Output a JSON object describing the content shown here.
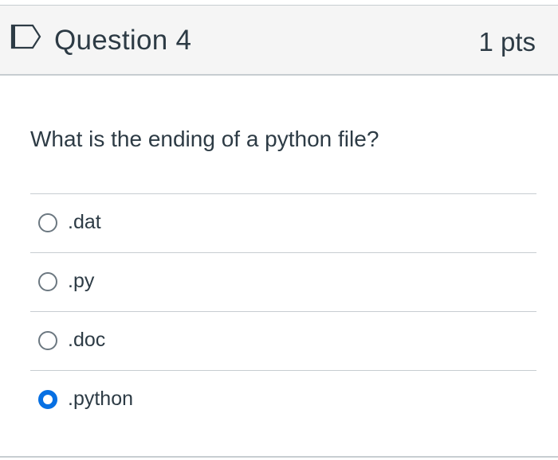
{
  "question": {
    "title": "Question 4",
    "points": "1 pts",
    "text": "What is the ending of a python file?",
    "flag_icon": "bookmark-flag-icon",
    "accent_color": "#0770e3"
  },
  "answers": [
    {
      "label": ".dat",
      "selected": false
    },
    {
      "label": ".py",
      "selected": false
    },
    {
      "label": ".doc",
      "selected": false
    },
    {
      "label": ".python",
      "selected": true
    }
  ]
}
